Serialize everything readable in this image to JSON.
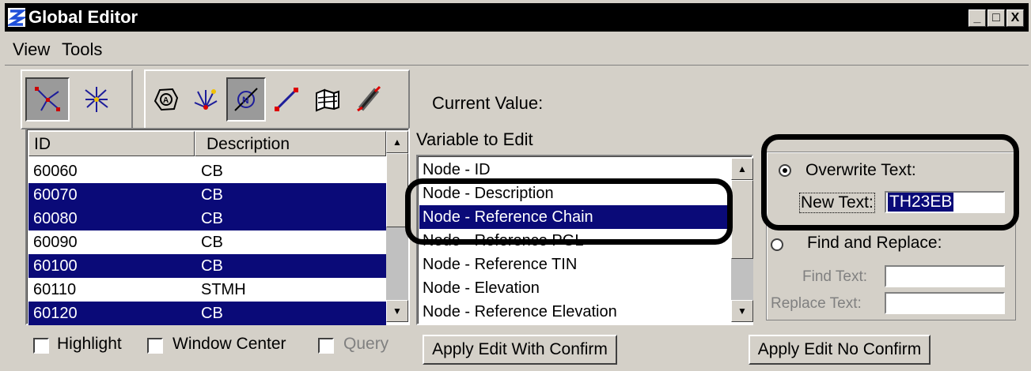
{
  "window": {
    "title": "Global Editor",
    "minimize_label": "_",
    "maximize_label": "□",
    "close_label": "X"
  },
  "menu": [
    {
      "label": "View"
    },
    {
      "label": "Tools"
    }
  ],
  "element_list": {
    "headers": {
      "id": "ID",
      "description": "Description"
    },
    "rows": [
      {
        "id": "60060",
        "description": "CB",
        "selected": false
      },
      {
        "id": "60070",
        "description": "CB",
        "selected": true
      },
      {
        "id": "60080",
        "description": "CB",
        "selected": true
      },
      {
        "id": "60090",
        "description": "CB",
        "selected": false
      },
      {
        "id": "60100",
        "description": "CB",
        "selected": true
      },
      {
        "id": "60110",
        "description": "STMH",
        "selected": false
      },
      {
        "id": "60120",
        "description": "CB",
        "selected": true
      }
    ]
  },
  "current_value_label": "Current Value:",
  "variable_list": {
    "label": "Variable to Edit",
    "items": [
      {
        "label": "Node - ID",
        "selected": false
      },
      {
        "label": "Node - Description",
        "selected": false
      },
      {
        "label": "Node - Reference Chain",
        "selected": true
      },
      {
        "label": "Node - Reference PGL",
        "selected": false
      },
      {
        "label": "Node - Reference TIN",
        "selected": false
      },
      {
        "label": "Node - Elevation",
        "selected": false
      },
      {
        "label": "Node - Reference Elevation",
        "selected": false
      }
    ]
  },
  "edit_options": {
    "overwrite_label": "Overwrite Text:",
    "new_text_label": "New Text:",
    "new_text_value": "TH23EB",
    "find_replace_label": "Find and Replace:",
    "find_text_label": "Find Text:",
    "find_text_value": "",
    "replace_text_label": "Replace Text:",
    "replace_text_value": ""
  },
  "checkboxes": {
    "highlight": "Highlight",
    "window_center": "Window Center",
    "query": "Query"
  },
  "buttons": {
    "apply_with_confirm": "Apply Edit With Confirm",
    "apply_no_confirm": "Apply Edit No Confirm"
  },
  "colors": {
    "selection": "#0a0a78",
    "window_bg": "#d4d0c8",
    "titlebar": "#000000"
  }
}
